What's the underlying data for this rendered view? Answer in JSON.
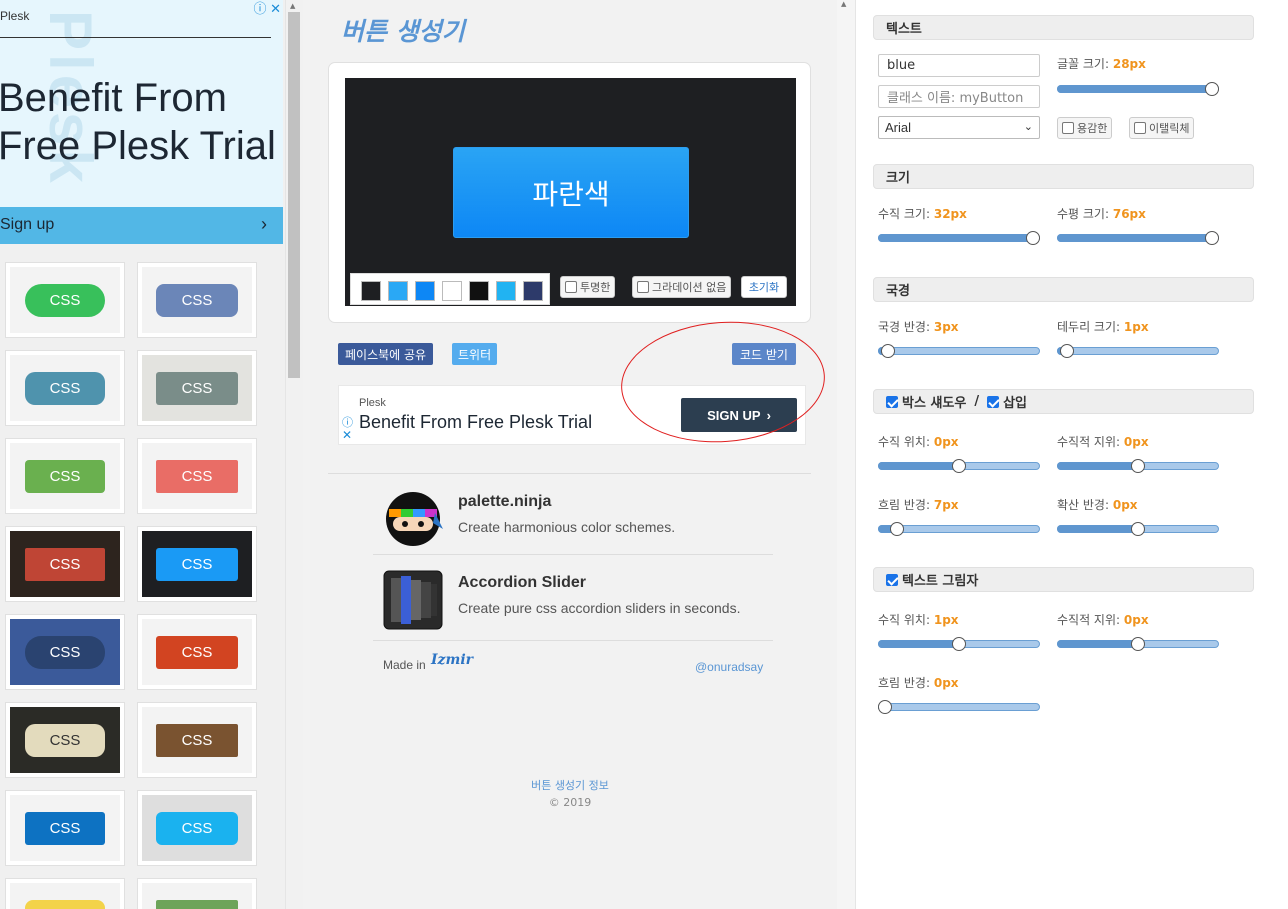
{
  "left_ad": {
    "brand": "Plesk",
    "headline_1": "Benefit From",
    "headline_2": "Free Plesk Trial",
    "watermark": "Plesk",
    "cta": "Sign up",
    "chevron": "›",
    "ad_icons": "ⓘ ✕"
  },
  "gallery": {
    "label": "CSS",
    "tiles": [
      {
        "col": 0,
        "row": 0,
        "bg": "#f3f3f3",
        "btn": "#38c05b",
        "text": "#ffffff",
        "radius": "20px"
      },
      {
        "col": 1,
        "row": 0,
        "bg": "#f3f3f3",
        "btn": "#6b86b8",
        "text": "#ffffff",
        "radius": "8px"
      },
      {
        "col": 0,
        "row": 1,
        "bg": "#f3f3f3",
        "btn": "#4f93ad",
        "text": "#ffffff",
        "radius": "10px"
      },
      {
        "col": 1,
        "row": 1,
        "bg": "#e3e3df",
        "btn": "#7a8d89",
        "text": "#ffffff",
        "radius": "3px"
      },
      {
        "col": 0,
        "row": 2,
        "bg": "#f3f3f3",
        "btn": "#6ab04f",
        "text": "#ffffff",
        "radius": "4px"
      },
      {
        "col": 1,
        "row": 2,
        "bg": "#f3f3f3",
        "btn": "#e96d66",
        "text": "#ffffff",
        "radius": "2px"
      },
      {
        "col": 0,
        "row": 3,
        "bg": "#2d241e",
        "btn": "#bf4535",
        "text": "#ffffff",
        "radius": "2px"
      },
      {
        "col": 1,
        "row": 3,
        "bg": "#1e1f22",
        "btn": "#1a9af5",
        "text": "#ffffff",
        "radius": "3px"
      },
      {
        "col": 0,
        "row": 4,
        "bg": "#3b5a9a",
        "btn": "#2a4370",
        "text": "#ffffff",
        "radius": "16px"
      },
      {
        "col": 1,
        "row": 4,
        "bg": "#f3f3f3",
        "btn": "#d24421",
        "text": "#ffffff",
        "radius": "3px"
      },
      {
        "col": 0,
        "row": 5,
        "bg": "#2b2b26",
        "btn": "#e3dbbd",
        "text": "#333333",
        "radius": "10px"
      },
      {
        "col": 1,
        "row": 5,
        "bg": "#f3f3f3",
        "btn": "#7a5330",
        "text": "#ffffff",
        "radius": "2px"
      },
      {
        "col": 0,
        "row": 6,
        "bg": "#f3f3f3",
        "btn": "#0d72c2",
        "text": "#ffffff",
        "radius": "3px"
      },
      {
        "col": 1,
        "row": 6,
        "bg": "#dedede",
        "btn": "#1ab2ef",
        "text": "#ffffff",
        "radius": "6px"
      },
      {
        "col": 0,
        "row": 7,
        "bg": "#f3f3f3",
        "btn": "#f3d34a",
        "text": "#ffffff",
        "radius": "8px"
      },
      {
        "col": 1,
        "row": 7,
        "bg": "#f3f3f3",
        "btn": "#6da45a",
        "text": "#ffffff",
        "radius": "2px"
      }
    ]
  },
  "app": {
    "title": "버튼 생성기",
    "preview_label": "파란색",
    "swatches": [
      "#1e1f22",
      "#2aa8f5",
      "#0d87f5",
      "#ffffff",
      "#111111",
      "#21b3f2",
      "#2d3a6a"
    ],
    "transparent_label": "투명한",
    "no_gradient_label": "그라데이션 없음",
    "reset_label": "초기화",
    "share_facebook": "페이스북에 공유",
    "share_twitter": "트위터",
    "get_code": "코드 받기"
  },
  "mid_ad": {
    "brand": "Plesk",
    "headline": "Benefit From Free Plesk Trial",
    "cta": "SIGN UP",
    "info_icon": "ⓘ",
    "close_icon": "✕"
  },
  "promos": [
    {
      "name": "palette.ninja",
      "desc": "Create harmonious color schemes."
    },
    {
      "name": "Accordion Slider",
      "desc": "Create pure css accordion sliders in seconds."
    }
  ],
  "footer": {
    "made_in": "Made in",
    "city": "Izmir",
    "handle": "@onuradsay",
    "about": "버튼 생성기 정보",
    "copyright": "© 2019"
  },
  "panel": {
    "text_section": "텍스트",
    "text_value": "blue",
    "class_placeholder": "클래스 이름: myButton",
    "font_value": "Arial",
    "font_size_label": "글꼴 크기:",
    "font_size_value": "28px",
    "bold_label": "용감한",
    "italic_label": "이탤릭체",
    "size_section": "크기",
    "vertical_size_label": "수직 크기:",
    "vertical_size_value": "32px",
    "horizontal_size_label": "수평 크기:",
    "horizontal_size_value": "76px",
    "border_section": "국경",
    "border_radius_label": "국경 반경:",
    "border_radius_value": "3px",
    "border_size_label": "테두리 크기:",
    "border_size_value": "1px",
    "box_shadow_label": "박스 섀도우",
    "slash": "/",
    "inset_label": "삽입",
    "bs_vpos_label": "수직 위치:",
    "bs_vpos_value": "0px",
    "bs_vpos2_label": "수직적 지위:",
    "bs_vpos2_value": "0px",
    "bs_blur_label": "흐림 반경:",
    "bs_blur_value": "7px",
    "bs_spread_label": "확산 반경:",
    "bs_spread_value": "0px",
    "text_shadow_label": "텍스트 그림자",
    "ts_vpos_label": "수직 위치:",
    "ts_vpos_value": "1px",
    "ts_vpos2_label": "수직적 지위:",
    "ts_vpos2_value": "0px",
    "ts_blur_label": "흐림 반경:",
    "ts_blur_value": "0px"
  },
  "sliders": {
    "font_size": 1.0,
    "vertical_size": 1.0,
    "horizontal_size": 1.0,
    "border_radius": 0.02,
    "border_size": 0.02,
    "bs_vpos": 0.5,
    "bs_vpos2": 0.5,
    "bs_blur": 0.08,
    "bs_spread": 0.5,
    "ts_vpos": 0.5,
    "ts_vpos2": 0.5,
    "ts_blur": 0.0
  }
}
